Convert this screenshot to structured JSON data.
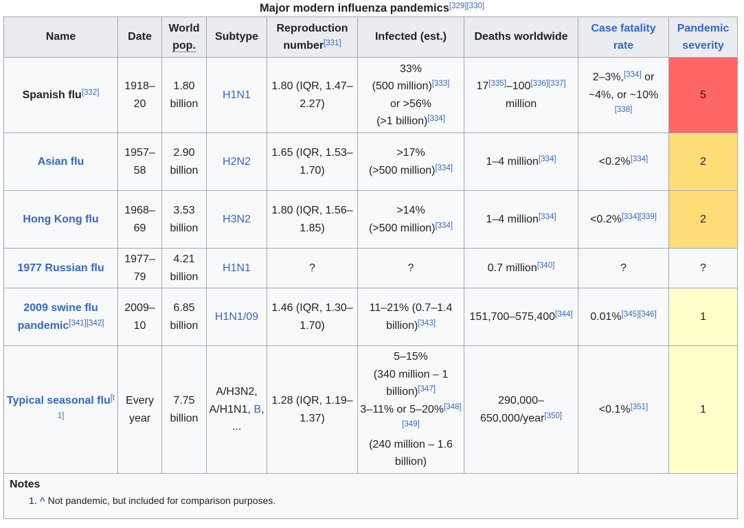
{
  "caption": {
    "title": "Major modern influenza pandemics",
    "refs": "[329][330]"
  },
  "headers": {
    "name": "Name",
    "date": "Date",
    "world_pop": {
      "line1": "World",
      "line2": "pop."
    },
    "subtype": "Subtype",
    "reproduction": {
      "text": "Reproduction number",
      "ref": "[331]"
    },
    "infected": "Infected (est.)",
    "deaths": "Deaths worldwide",
    "cfr": "Case fatality rate",
    "severity": "Pandemic severity"
  },
  "rows": [
    {
      "name": "Spanish flu",
      "name_ref": "[332]",
      "date": "1918–20",
      "pop": "1.80 billion",
      "subtype": "H1N1",
      "r0": "1.80 (IQR, 1.47–2.27)",
      "infected": {
        "a": "33%",
        "b": "(500 million)",
        "b_ref": "[333]",
        "c": "or >56%",
        "d": "(>1 billion)",
        "d_ref": "[334]"
      },
      "deaths": {
        "a": "17",
        "a_ref": "[335]",
        "b": "–100",
        "b_ref": "[336][337]",
        "c": " million"
      },
      "cfr": {
        "a": "2–3%,",
        "a_ref": "[334]",
        "b": " or ~4%, or ~10%",
        "b_ref": "[338]"
      },
      "severity": "5"
    },
    {
      "name": "Asian flu",
      "date": "1957–58",
      "pop": "2.90 billion",
      "subtype": "H2N2",
      "r0": "1.65 (IQR, 1.53–1.70)",
      "infected": {
        "a": ">17%",
        "b": "(>500 million)",
        "b_ref": "[334]"
      },
      "deaths": {
        "a": "1–4 million",
        "a_ref": "[334]"
      },
      "cfr": {
        "a": "<0.2%",
        "a_ref": "[334]"
      },
      "severity": "2"
    },
    {
      "name": "Hong Kong flu",
      "date": "1968–69",
      "pop": "3.53 billion",
      "subtype": "H3N2",
      "r0": "1.80 (IQR, 1.56–1.85)",
      "infected": {
        "a": ">14%",
        "b": "(>500 million)",
        "b_ref": "[334]"
      },
      "deaths": {
        "a": "1–4 million",
        "a_ref": "[334]"
      },
      "cfr": {
        "a": "<0.2%",
        "a_ref": "[334][339]"
      },
      "severity": "2"
    },
    {
      "name": "1977 Russian flu",
      "date": "1977–79",
      "pop": "4.21 billion",
      "subtype": "H1N1",
      "r0": "?",
      "infected": {
        "a": "?"
      },
      "deaths": {
        "a": "0.7 million",
        "a_ref": "[340]"
      },
      "cfr": {
        "a": "?"
      },
      "severity": "?"
    },
    {
      "name": "2009 swine flu pandemic",
      "name_ref": "[341][342]",
      "date": "2009–10",
      "pop": "6.85 billion",
      "subtype": "H1N1/09",
      "r0": "1.46 (IQR, 1.30–1.70)",
      "infected": {
        "a": "11–21% (0.7–1.4 billion)",
        "a_ref": "[343]"
      },
      "deaths": {
        "a": "151,700–575,400",
        "a_ref": "[344]"
      },
      "cfr": {
        "a": "0.01%",
        "a_ref": "[345][346]"
      },
      "severity": "1"
    },
    {
      "name": "Typical seasonal flu",
      "name_ref": "[t 1]",
      "date": "Every year",
      "pop": "7.75 billion",
      "subtype": {
        "a": "A/H3N2, A/H1N1, ",
        "b": "B",
        "c": ", ..."
      },
      "r0": "1.28 (IQR, 1.19–1.37)",
      "infected": {
        "a": "5–15%",
        "b": "(340 million – 1 billion)",
        "b_ref": "[347]",
        "c": "3–11% or 5–20%",
        "c_ref": "[348][349]",
        "d": "(240 million – 1.6 billion)"
      },
      "deaths": {
        "a": "290,000–650,000/year",
        "a_ref": "[350]"
      },
      "cfr": {
        "a": "<0.1%",
        "a_ref": "[351]"
      },
      "severity": "1"
    }
  ],
  "notes": {
    "title": "Notes",
    "items": [
      {
        "num": "1.",
        "caret": "^",
        "text": "Not pandemic, but included for comparison purposes."
      }
    ]
  },
  "colors": {
    "severity_5": "#ff6666",
    "severity_2": "#ffdd77",
    "severity_1": "#ffffcc",
    "link": "#3366cc"
  }
}
